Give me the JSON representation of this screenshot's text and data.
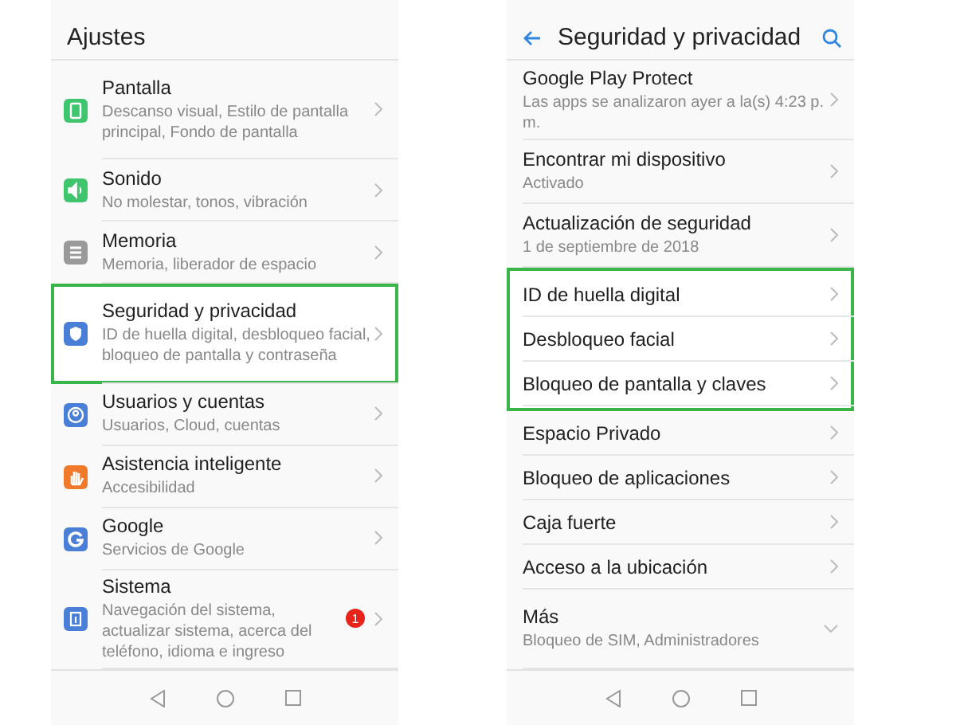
{
  "left_screen": {
    "title": "Ajustes",
    "items": [
      {
        "kind": "display",
        "title": "Pantalla",
        "subtitle": "Descanso visual, Estilo de pantalla principal, Fondo de pantalla",
        "highlighted": false
      },
      {
        "kind": "sound",
        "title": "Sonido",
        "subtitle": "No molestar, tonos, vibración",
        "highlighted": false
      },
      {
        "kind": "storage",
        "title": "Memoria",
        "subtitle": "Memoria, liberador de espacio",
        "highlighted": false
      },
      {
        "kind": "security",
        "title": "Seguridad y privacidad",
        "subtitle": "ID de huella digital, desbloqueo facial, bloqueo de pantalla y contraseña",
        "highlighted": true
      },
      {
        "kind": "users",
        "title": "Usuarios y cuentas",
        "subtitle": "Usuarios, Cloud, cuentas",
        "highlighted": false
      },
      {
        "kind": "assist",
        "title": "Asistencia inteligente",
        "subtitle": "Accesibilidad",
        "highlighted": false
      },
      {
        "kind": "google",
        "title": "Google",
        "subtitle": "Servicios de Google",
        "highlighted": false
      },
      {
        "kind": "system",
        "title": "Sistema",
        "subtitle": "Navegación del sistema, actualizar sistema, acerca del teléfono, idioma e ingreso",
        "highlighted": false,
        "badge": "1"
      }
    ]
  },
  "right_screen": {
    "title": "Seguridad y privacidad",
    "groups": [
      {
        "highlighted": false,
        "items": [
          {
            "title": "Google Play Protect",
            "subtitle": "Las apps se analizaron ayer a la(s) 4:23 p. m."
          },
          {
            "title": "Encontrar mi dispositivo",
            "subtitle": "Activado"
          },
          {
            "title": "Actualización de seguridad",
            "subtitle": "1 de septiembre de 2018"
          }
        ]
      },
      {
        "highlighted": true,
        "items": [
          {
            "title": "ID de huella digital"
          },
          {
            "title": "Desbloqueo facial"
          },
          {
            "title": "Bloqueo de pantalla y claves"
          }
        ]
      },
      {
        "highlighted": false,
        "items": [
          {
            "title": "Espacio Privado"
          },
          {
            "title": "Bloqueo de aplicaciones"
          },
          {
            "title": "Caja fuerte"
          },
          {
            "title": "Acceso a la ubicación"
          }
        ]
      },
      {
        "highlighted": false,
        "items": [
          {
            "title": "Más",
            "subtitle": "Bloqueo de SIM, Administradores",
            "expandable": true
          }
        ]
      }
    ]
  }
}
